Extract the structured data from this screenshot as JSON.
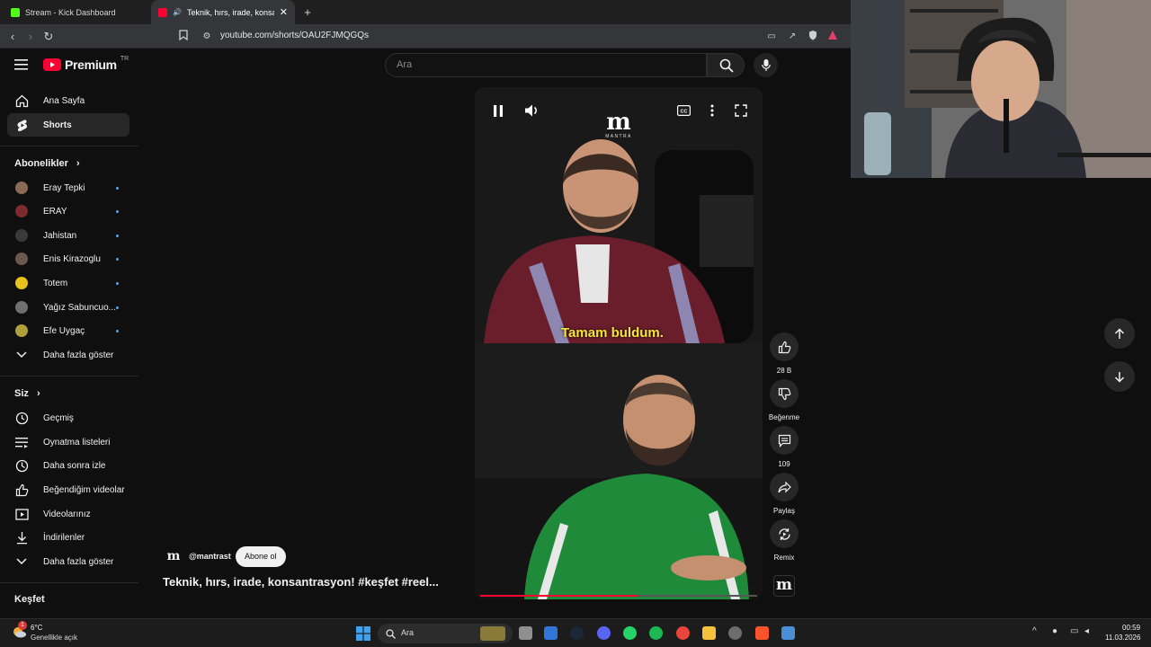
{
  "browser": {
    "tabs": [
      {
        "title": "Stream - Kick Dashboard",
        "favicon_color": "#53fc18",
        "active": false
      },
      {
        "title": "Teknik, hırs, irade, konsantras",
        "favicon_color": "#ff0033",
        "active": true
      }
    ],
    "new_tab": "+",
    "url": "youtube.com/shorts/OAU2FJMQGQs"
  },
  "youtube": {
    "logo_text": "Premium",
    "region": "TR",
    "search_placeholder": "Ara"
  },
  "sidebar": {
    "main_items": [
      {
        "label": "Ana Sayfa",
        "icon": "home-icon"
      },
      {
        "label": "Shorts",
        "icon": "shorts-icon",
        "active": true
      }
    ],
    "subscriptions_header": "Abonelikler",
    "subscriptions": [
      {
        "label": "Eray Tepki",
        "color": "#8a6a55"
      },
      {
        "label": "ERAY",
        "color": "#7b2b2b"
      },
      {
        "label": "Jahistan",
        "color": "#3a3a3a"
      },
      {
        "label": "Enis Kirazoglu",
        "color": "#6b5b4e"
      },
      {
        "label": "Totem",
        "color": "#e8c21a"
      },
      {
        "label": "Yağız Sabuncuo...",
        "color": "#6f6f6f"
      },
      {
        "label": "Efe Uygaç",
        "color": "#b0a03a"
      }
    ],
    "show_more_subs": "Daha fazla göster",
    "you_header": "Siz",
    "you_items": [
      {
        "label": "Geçmiş",
        "icon": "history-icon"
      },
      {
        "label": "Oynatma listeleri",
        "icon": "playlist-icon"
      },
      {
        "label": "Daha sonra izle",
        "icon": "clock-icon"
      },
      {
        "label": "Beğendiğim videolar",
        "icon": "like-icon"
      },
      {
        "label": "Videolarınız",
        "icon": "video-icon"
      },
      {
        "label": "İndirilenler",
        "icon": "download-icon"
      }
    ],
    "show_more_you": "Daha fazla göster",
    "explore_header": "Keşfet"
  },
  "video": {
    "channel_watermark": "MANTRA",
    "subtitle": "Tamam buldum.",
    "progress": 0.57,
    "channel_handle": "@mantrast",
    "subscribe_label": "Abone ol",
    "title": "Teknik, hırs, irade, konsantrasyon! #keşfet #reel..."
  },
  "actions": {
    "like_count": "28 B",
    "dislike_label": "Beğenme",
    "comment_count": "109",
    "share_label": "Paylaş",
    "remix_label": "Remix"
  },
  "taskbar": {
    "weather_temp": "6°C",
    "weather_desc": "Genellikle açık",
    "weather_badge": "1",
    "search_label": "Ara",
    "time": "00:59",
    "date": "11.03.2026"
  }
}
